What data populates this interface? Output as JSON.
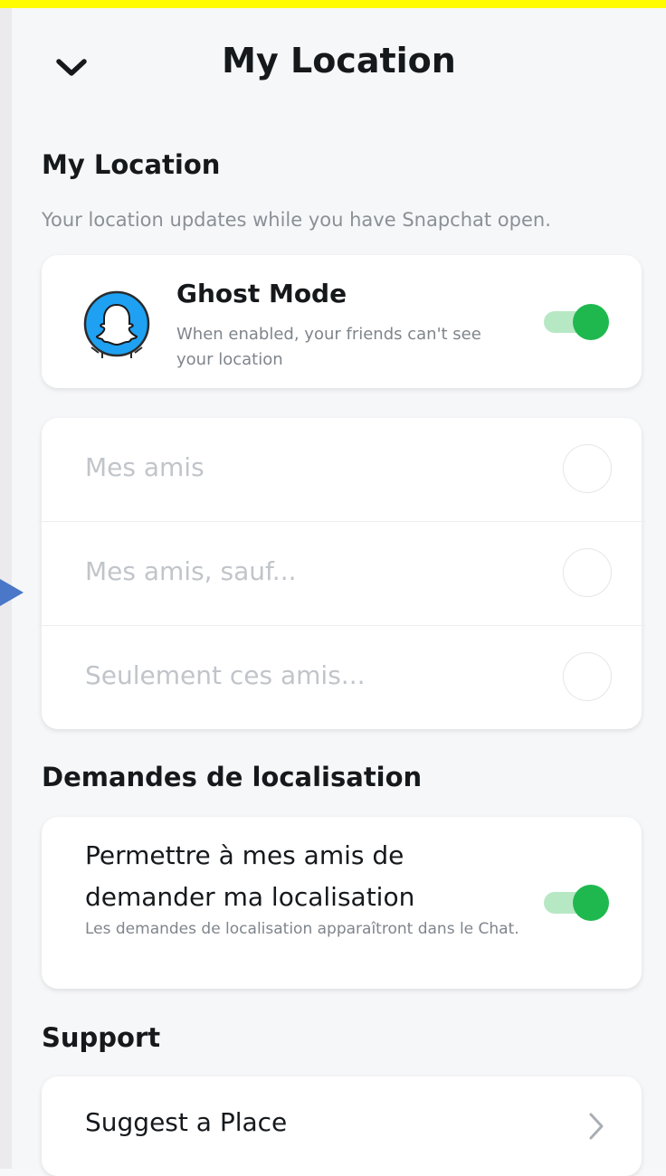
{
  "header": {
    "title": "My Location",
    "back_icon": "chevron-down-icon"
  },
  "location_section": {
    "title": "My Location",
    "description": "Your location updates while you have Snapchat open."
  },
  "ghost_mode": {
    "title": "Ghost Mode",
    "description": "When enabled, your friends can't see your location",
    "enabled": true,
    "avatar_icon": "ghost-avatar-icon"
  },
  "share_options": [
    {
      "label": "Mes amis",
      "selected": false
    },
    {
      "label": "Mes amis, sauf...",
      "selected": false
    },
    {
      "label": "Seulement ces amis...",
      "selected": false
    }
  ],
  "requests_section": {
    "title": "Demandes de localisation",
    "toggle_title": "Permettre à mes amis de demander ma localisation",
    "toggle_description": "Les demandes de localisation apparaîtront dans le Chat.",
    "enabled": true
  },
  "support_section": {
    "title": "Support",
    "item_label": "Suggest a Place",
    "item_icon": "chevron-right-icon"
  },
  "colors": {
    "snap_yellow": "#fffc00",
    "toggle_on": "#1fb84f",
    "toggle_track": "#b7e8c4",
    "avatar_blue": "#1ea1f2",
    "annotation_arrow": "#4a77c8"
  }
}
